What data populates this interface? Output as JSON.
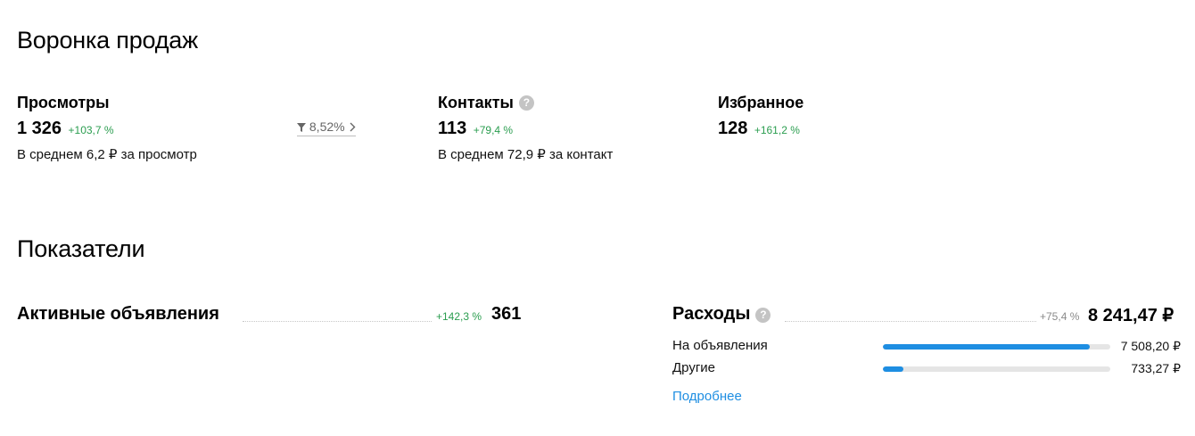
{
  "funnel": {
    "title": "Воронка продаж",
    "views": {
      "label": "Просмотры",
      "value": "1 326",
      "delta": "+103,7 %",
      "avg": "В среднем 6,2 ₽ за просмотр",
      "conversion": "8,52%"
    },
    "contacts": {
      "label": "Контакты",
      "value": "113",
      "delta": "+79,4 %",
      "avg": "В среднем 72,9 ₽ за контакт"
    },
    "favorites": {
      "label": "Избранное",
      "value": "128",
      "delta": "+161,2 %"
    }
  },
  "metrics": {
    "title": "Показатели",
    "active_ads": {
      "label": "Активные объявления",
      "delta": "+142,3 %",
      "value": "361"
    },
    "expenses": {
      "label": "Расходы",
      "delta": "+75,4 %",
      "value": "8 241,47 ₽",
      "rows": [
        {
          "label": "На объявления",
          "value": "7 508,20 ₽",
          "fill_fraction": 0.911
        },
        {
          "label": "Другие",
          "value": "733,27 ₽",
          "fill_fraction": 0.089
        }
      ],
      "details_link": "Подробнее"
    }
  },
  "colors": {
    "positive": "#2a9d4f",
    "accent": "#1e8ee2",
    "muted": "#8a8a8a"
  }
}
